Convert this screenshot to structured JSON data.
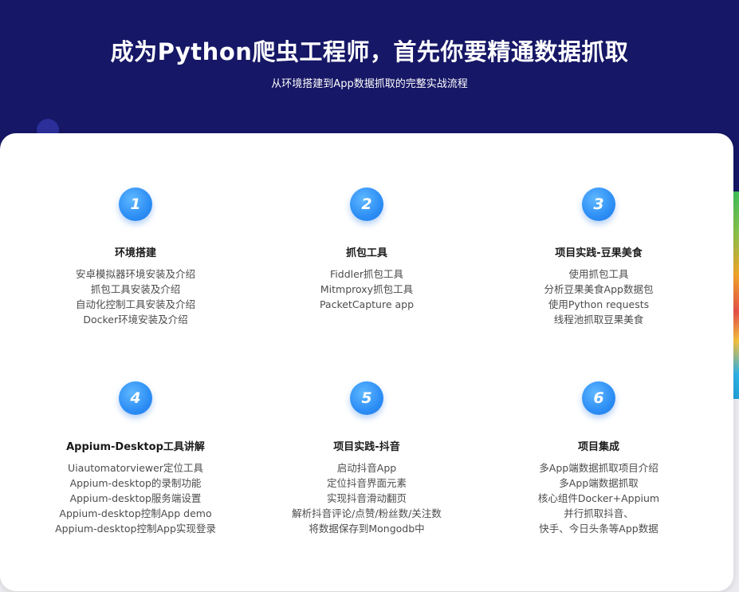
{
  "hero": {
    "title": "成为Python爬虫工程师，首先你要精通数据抓取",
    "subtitle": "从环境搭建到App数据抓取的完整实战流程"
  },
  "steps": [
    {
      "number": "1",
      "title": "环境搭建",
      "items": [
        "安卓模拟器环境安装及介绍",
        "抓包工具安装及介绍",
        "自动化控制工具安装及介绍",
        "Docker环境安装及介绍"
      ]
    },
    {
      "number": "2",
      "title": "抓包工具",
      "items": [
        "Fiddler抓包工具",
        "Mitmproxy抓包工具",
        "PacketCapture app"
      ]
    },
    {
      "number": "3",
      "title": "项目实践-豆果美食",
      "items": [
        "使用抓包工具",
        "分析豆果美食App数据包",
        "使用Python requests",
        "线程池抓取豆果美食"
      ]
    },
    {
      "number": "4",
      "title": "Appium-Desktop工具讲解",
      "items": [
        "Uiautomatorviewer定位工具",
        "Appium-desktop的录制功能",
        "Appium-desktop服务端设置",
        "Appium-desktop控制App demo",
        "Appium-desktop控制App实现登录"
      ]
    },
    {
      "number": "5",
      "title": "项目实践-抖音",
      "items": [
        "启动抖音App",
        "定位抖音界面元素",
        "实现抖音滑动翻页",
        "解析抖音评论/点赞/粉丝数/关注数",
        "将数据保存到Mongodb中"
      ]
    },
    {
      "number": "6",
      "title": "项目集成",
      "items": [
        "多App端数据抓取项目介绍",
        "多App端数据抓取",
        "核心组件Docker+Appium",
        "并行抓取抖音、",
        "快手、今日头条等App数据"
      ]
    }
  ],
  "colors": {
    "hero_background": "#161766",
    "badge_blue": "#2d8ef5",
    "card_background": "#ffffff"
  }
}
